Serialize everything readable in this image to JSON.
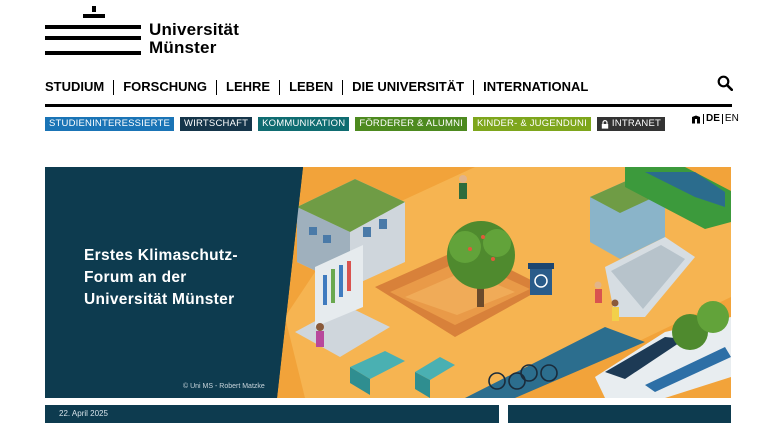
{
  "logo": {
    "line1": "Universität",
    "line2": "Münster"
  },
  "nav": {
    "items": [
      "STUDIUM",
      "FORSCHUNG",
      "LEHRE",
      "LEBEN",
      "DIE UNIVERSITÄT",
      "INTERNATIONAL"
    ],
    "search_icon": "search-icon"
  },
  "tags": [
    {
      "label": "STUDIENINTERESSIERTE",
      "color": "#1a74b6"
    },
    {
      "label": "WIRTSCHAFT",
      "color": "#15354a"
    },
    {
      "label": "KOMMUNIKATION",
      "color": "#0f6c71"
    },
    {
      "label": "FÖRDERER & ALUMNI",
      "color": "#4d8a1f"
    },
    {
      "label": "KINDER- & JUGENDUNI",
      "color": "#7ea61c"
    },
    {
      "label": "INTRANET",
      "color": "#333333",
      "icon": "lock-icon"
    }
  ],
  "language": {
    "current": "DE",
    "other": "EN",
    "icon": "accessibility-icon"
  },
  "hero": {
    "title_lines": [
      "Erstes Klimaschutz-",
      "Forum an der",
      "Universität Münster"
    ],
    "credit": "© Uni MS - Robert Matzke"
  },
  "news": {
    "date": "22. April 2025"
  },
  "colors": {
    "hero_bg": "#0d3b4f",
    "accent_orange": "#f2a33a"
  }
}
